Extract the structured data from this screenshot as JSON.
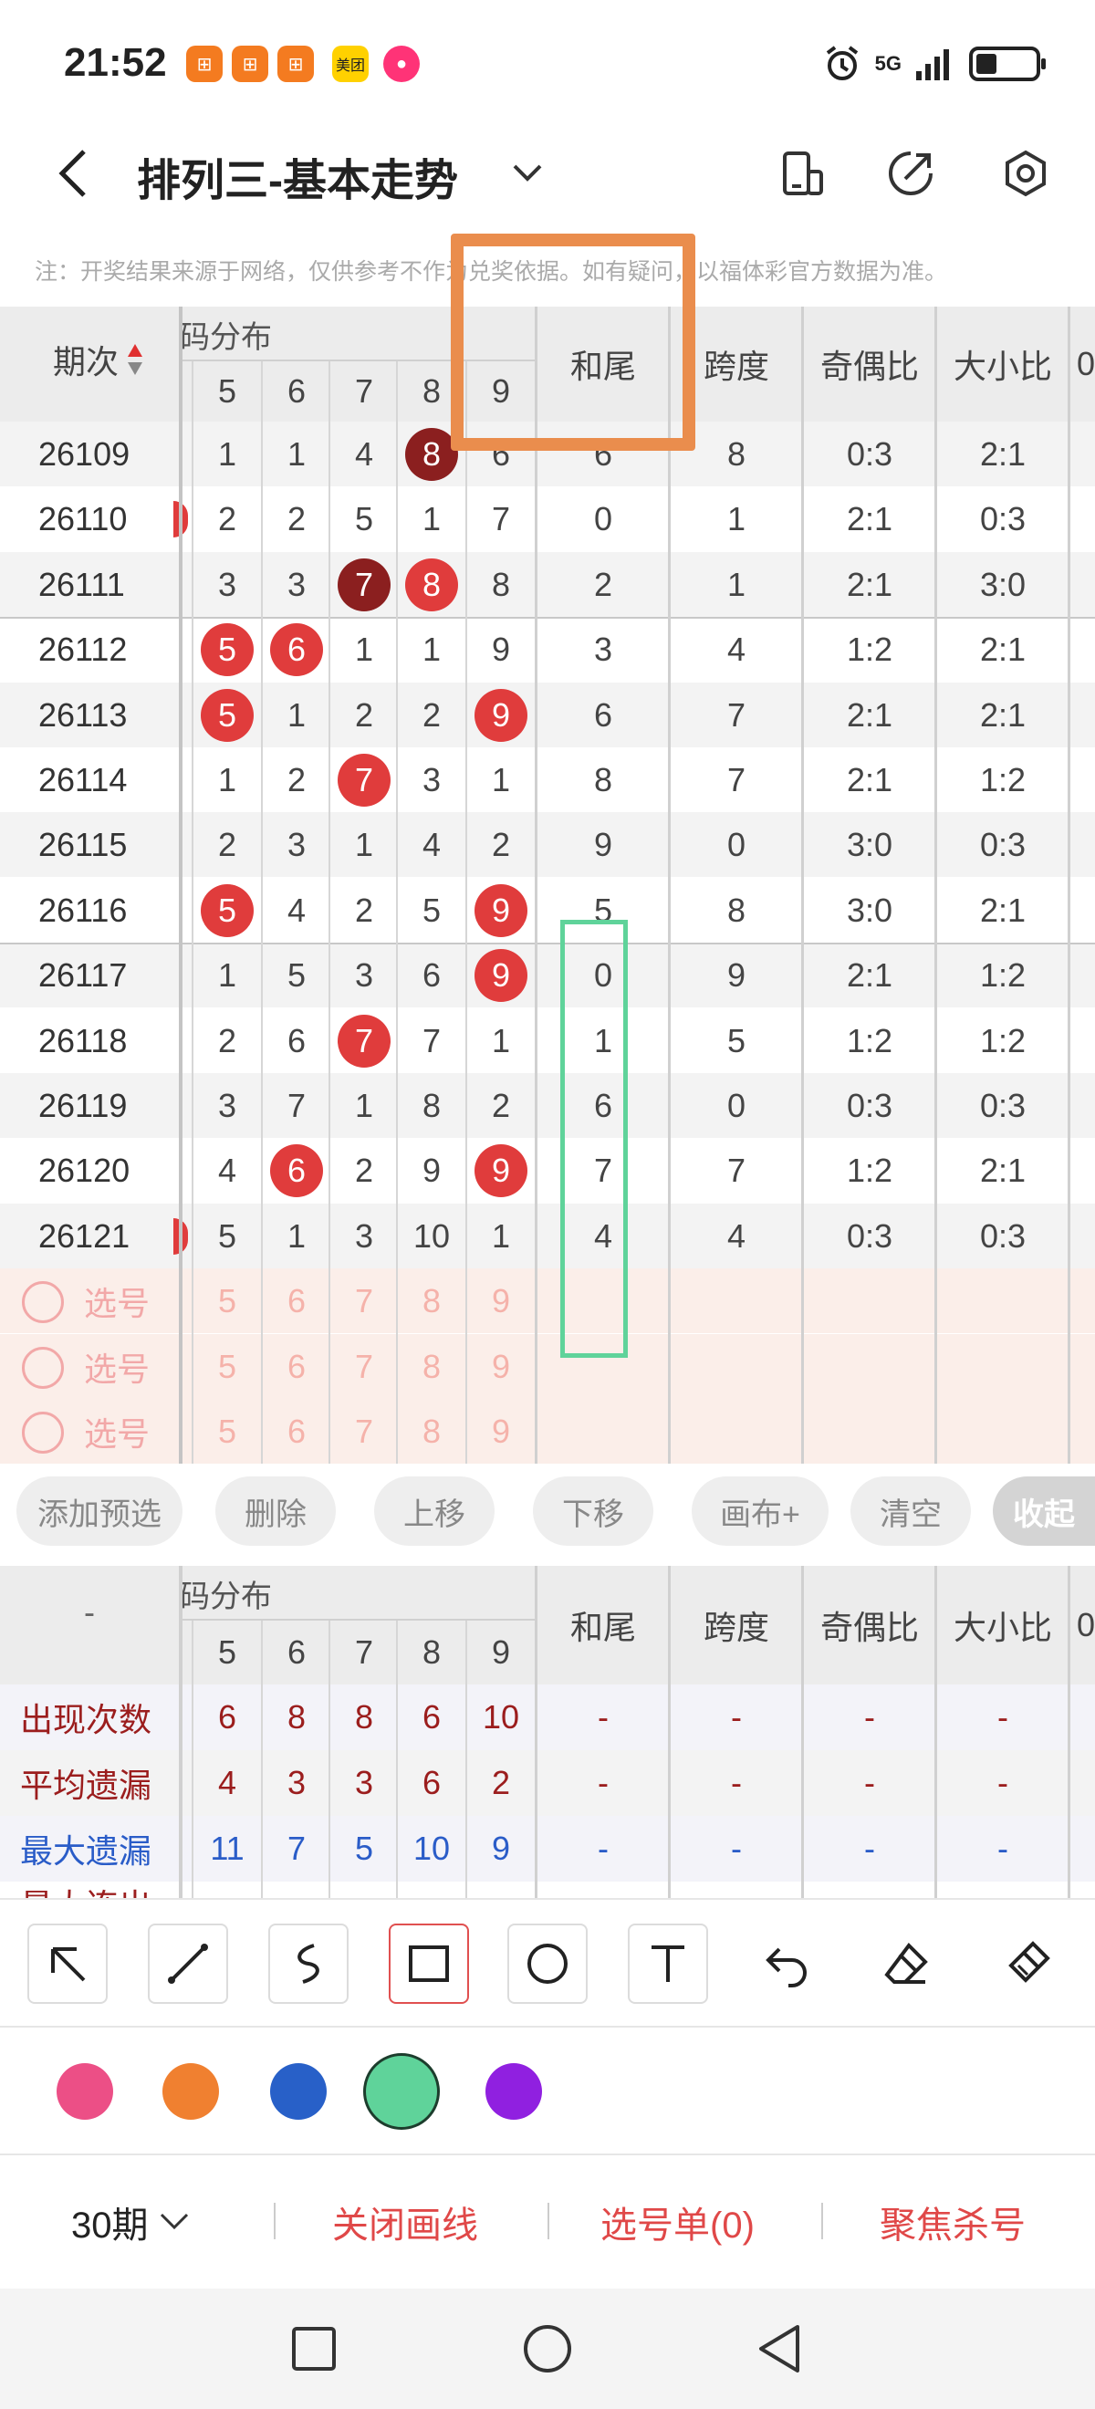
{
  "status": {
    "time": "21:52",
    "app_icons": [
      "美团"
    ],
    "network": "5G"
  },
  "header": {
    "title": "排列三-基本走势"
  },
  "notice": "注：开奖结果来源于网络，仅供参考不作为兑奖依据。如有疑问，以福体彩官方数据为准。",
  "table": {
    "col_issue": "期次",
    "group_label": "号码分布",
    "digit_headers": [
      "5",
      "6",
      "7",
      "8",
      "9"
    ],
    "col_hewei": "和尾",
    "col_kuadu": "跨度",
    "col_jiou": "奇偶比",
    "col_daxiao": "大小比",
    "rows": [
      {
        "issue": "26109",
        "d": [
          "1",
          "1",
          "4",
          "8",
          "6"
        ],
        "hit": [
          null,
          null,
          null,
          "dark",
          null
        ],
        "hewei": "6",
        "kuadu": "8",
        "jiou": "0:3",
        "daxiao": "2:1"
      },
      {
        "issue": "26110",
        "d": [
          "2",
          "2",
          "5",
          "1",
          "7"
        ],
        "hit": [
          null,
          null,
          null,
          null,
          null
        ],
        "hewei": "0",
        "kuadu": "1",
        "jiou": "2:1",
        "daxiao": "0:3"
      },
      {
        "issue": "26111",
        "d": [
          "3",
          "3",
          "7",
          "8",
          "8"
        ],
        "hit": [
          null,
          null,
          "dark",
          "red",
          null
        ],
        "hewei": "2",
        "kuadu": "1",
        "jiou": "2:1",
        "daxiao": "3:0"
      },
      {
        "issue": "26112",
        "d": [
          "5",
          "6",
          "1",
          "1",
          "9"
        ],
        "hit": [
          "red",
          "red",
          null,
          null,
          null
        ],
        "hewei": "3",
        "kuadu": "4",
        "jiou": "1:2",
        "daxiao": "2:1"
      },
      {
        "issue": "26113",
        "d": [
          "5",
          "1",
          "2",
          "2",
          "9"
        ],
        "hit": [
          "red",
          null,
          null,
          null,
          "red"
        ],
        "hewei": "6",
        "kuadu": "7",
        "jiou": "2:1",
        "daxiao": "2:1"
      },
      {
        "issue": "26114",
        "d": [
          "1",
          "2",
          "7",
          "3",
          "1"
        ],
        "hit": [
          null,
          null,
          "red",
          null,
          null
        ],
        "hewei": "8",
        "kuadu": "7",
        "jiou": "2:1",
        "daxiao": "1:2"
      },
      {
        "issue": "26115",
        "d": [
          "2",
          "3",
          "1",
          "4",
          "2"
        ],
        "hit": [
          null,
          null,
          null,
          null,
          null
        ],
        "hewei": "9",
        "kuadu": "0",
        "jiou": "3:0",
        "daxiao": "0:3"
      },
      {
        "issue": "26116",
        "d": [
          "5",
          "4",
          "2",
          "5",
          "9"
        ],
        "hit": [
          "red",
          null,
          null,
          null,
          "red"
        ],
        "hewei": "5",
        "kuadu": "8",
        "jiou": "3:0",
        "daxiao": "2:1"
      },
      {
        "issue": "26117",
        "d": [
          "1",
          "5",
          "3",
          "6",
          "9"
        ],
        "hit": [
          null,
          null,
          null,
          null,
          "red"
        ],
        "hewei": "0",
        "kuadu": "9",
        "jiou": "2:1",
        "daxiao": "1:2"
      },
      {
        "issue": "26118",
        "d": [
          "2",
          "6",
          "7",
          "7",
          "1"
        ],
        "hit": [
          null,
          null,
          "red",
          null,
          null
        ],
        "hewei": "1",
        "kuadu": "5",
        "jiou": "1:2",
        "daxiao": "1:2"
      },
      {
        "issue": "26119",
        "d": [
          "3",
          "7",
          "1",
          "8",
          "2"
        ],
        "hit": [
          null,
          null,
          null,
          null,
          null
        ],
        "hewei": "6",
        "kuadu": "0",
        "jiou": "0:3",
        "daxiao": "0:3"
      },
      {
        "issue": "26120",
        "d": [
          "4",
          "6",
          "2",
          "9",
          "9"
        ],
        "hit": [
          null,
          "red",
          null,
          null,
          "red"
        ],
        "hewei": "7",
        "kuadu": "7",
        "jiou": "1:2",
        "daxiao": "2:1"
      },
      {
        "issue": "26121",
        "d": [
          "5",
          "1",
          "3",
          "10",
          "1"
        ],
        "hit": [
          null,
          null,
          null,
          null,
          null
        ],
        "hewei": "4",
        "kuadu": "4",
        "jiou": "0:3",
        "daxiao": "0:3"
      }
    ],
    "pick_label": "选号",
    "pick_nums": [
      "5",
      "6",
      "7",
      "8",
      "9"
    ]
  },
  "actions": [
    "添加预选",
    "删除",
    "上移",
    "下移",
    "画布+",
    "清空",
    "收起"
  ],
  "stats": {
    "dash": "-",
    "group_label": "号码分布",
    "digit_headers": [
      "5",
      "6",
      "7",
      "8",
      "9"
    ],
    "cols": [
      "和尾",
      "跨度",
      "奇偶比",
      "大小比"
    ],
    "rows": [
      {
        "label": "出现次数",
        "vals": [
          "6",
          "8",
          "8",
          "6",
          "10"
        ],
        "color": "#9b1d1d"
      },
      {
        "label": "平均遗漏",
        "vals": [
          "4",
          "3",
          "3",
          "6",
          "2"
        ],
        "color": "#9b1d1d"
      },
      {
        "label": "最大遗漏",
        "vals": [
          "11",
          "7",
          "5",
          "10",
          "9"
        ],
        "color": "#2a5cc8"
      }
    ]
  },
  "tools": [
    "arrow",
    "line",
    "curve",
    "rect",
    "circle",
    "text",
    "undo",
    "eraser",
    "clear"
  ],
  "colors": [
    "#ec4f86",
    "#f08030",
    "#2860c8",
    "#5fd39a",
    "#9020e0"
  ],
  "bottom": {
    "period": "30期",
    "close_draw": "关闭画线",
    "pick_list": "选号单(0)",
    "focus_kill": "聚焦杀号"
  }
}
